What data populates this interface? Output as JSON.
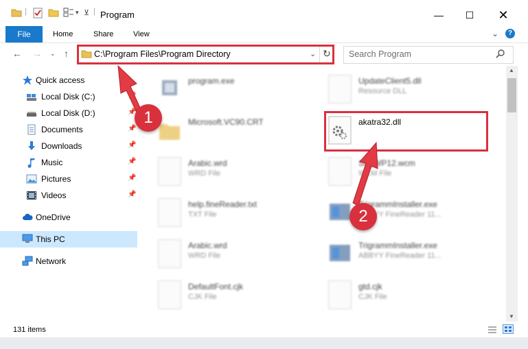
{
  "window": {
    "title": "Program"
  },
  "ribbon": {
    "tabs": [
      "File",
      "Home",
      "Share",
      "View"
    ]
  },
  "address_bar": {
    "path": "C:\\Program Files\\Program Directory"
  },
  "search": {
    "placeholder": "Search Program"
  },
  "sidebar": {
    "quick_access": "Quick access",
    "items": [
      {
        "label": "Local Disk (C:)",
        "icon": "drive-icon"
      },
      {
        "label": "Local Disk (D:)",
        "icon": "drive-icon"
      },
      {
        "label": "Documents",
        "icon": "documents-icon"
      },
      {
        "label": "Downloads",
        "icon": "downloads-icon"
      },
      {
        "label": "Music",
        "icon": "music-icon"
      },
      {
        "label": "Pictures",
        "icon": "pictures-icon"
      },
      {
        "label": "Videos",
        "icon": "videos-icon"
      }
    ],
    "onedrive": "OneDrive",
    "this_pc": "This PC",
    "network": "Network"
  },
  "files": {
    "left": [
      {
        "name": "program.exe",
        "type": ""
      },
      {
        "name": "Microsoft.VC90.CRT",
        "type": ""
      },
      {
        "name": "Arabic.wrd",
        "type": "WRD File"
      },
      {
        "name": "help.fineReader.txt",
        "type": "TXT File"
      },
      {
        "name": "Arabic.wrd",
        "type": "WRD File"
      },
      {
        "name": "DefaultFont.cjk",
        "type": "CJK File"
      }
    ],
    "right": [
      {
        "name": "UpdateClient5.dll",
        "type": "Resource DLL"
      },
      {
        "name": "akatra32.dll",
        "type": ""
      },
      {
        "name": "StrgWP12.wcm",
        "type": "WCM File"
      },
      {
        "name": "TrigrammInstaller.exe",
        "type": "ABBYY FineReader 11..."
      },
      {
        "name": "TrigrammInstaller.exe",
        "type": "ABBYY FineReader 11..."
      },
      {
        "name": "gtd.cjk",
        "type": "CJK File"
      }
    ]
  },
  "status": {
    "count": "131 items"
  },
  "annotations": {
    "badge1": "1",
    "badge2": "2"
  },
  "colors": {
    "accent": "#1979ca",
    "highlight": "#d9303e",
    "selection": "#cce8ff"
  }
}
